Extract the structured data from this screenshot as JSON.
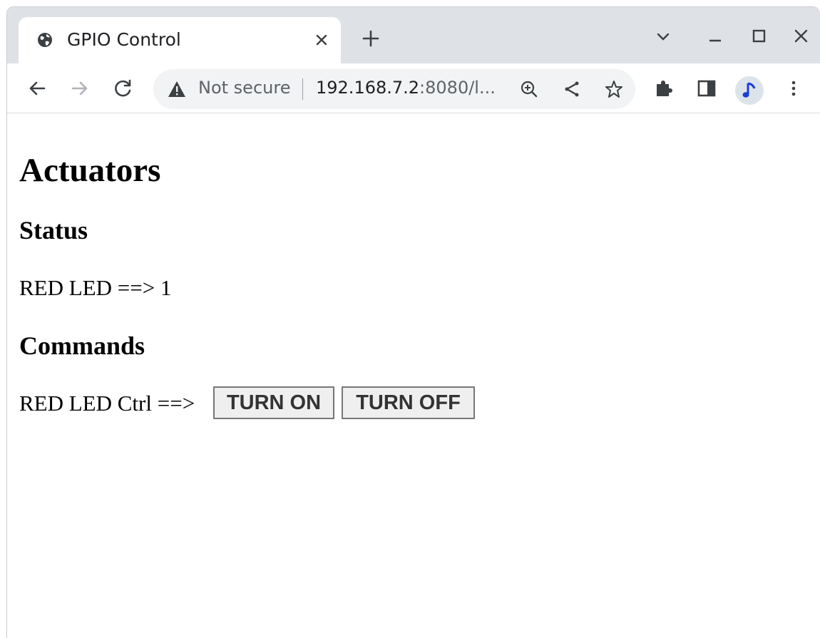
{
  "browser": {
    "tab": {
      "title": "GPIO Control",
      "favicon": "globe-icon"
    },
    "omnibox": {
      "security_label": "Not secure",
      "url_host": "192.168.7.2",
      "url_rest": ":8080/l..."
    },
    "avatar_icon": "music-note-icon",
    "colors": {
      "tabstrip": "#dee1e6",
      "omnibox": "#f1f3f4",
      "avatar_note": "#1a3fd6"
    }
  },
  "page": {
    "title": "Actuators",
    "status": {
      "heading": "Status",
      "red_led_text": "RED LED ==> 1"
    },
    "commands": {
      "heading": "Commands",
      "red_led_ctrl_label": "RED LED Ctrl ==>",
      "turn_on_label": "TURN ON",
      "turn_off_label": "TURN OFF"
    }
  }
}
